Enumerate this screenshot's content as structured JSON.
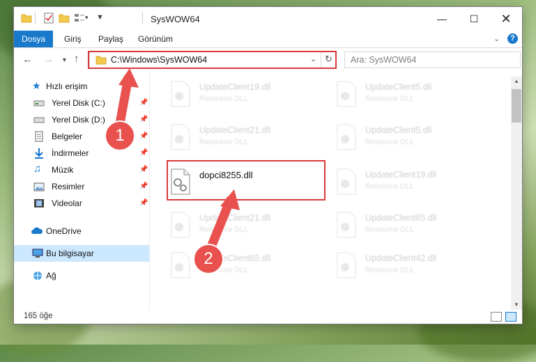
{
  "window": {
    "title": "SysWOW64"
  },
  "ribbon": {
    "tabs": [
      "Dosya",
      "Giriş",
      "Paylaş",
      "Görünüm"
    ]
  },
  "address": {
    "path": "C:\\Windows\\SysWOW64",
    "search_placeholder": "Ara: SysWOW64"
  },
  "sidebar": {
    "quick_access": "Hızlı erişim",
    "items": [
      {
        "label": "Yerel Disk (C:)",
        "icon": "drive-icon"
      },
      {
        "label": "Yerel Disk (D:)",
        "icon": "drive-icon"
      },
      {
        "label": "Belgeler",
        "icon": "documents-icon"
      },
      {
        "label": "İndirmeler",
        "icon": "downloads-icon"
      },
      {
        "label": "Müzik",
        "icon": "music-icon"
      },
      {
        "label": "Resimler",
        "icon": "pictures-icon"
      },
      {
        "label": "Videolar",
        "icon": "videos-icon"
      }
    ],
    "onedrive": "OneDrive",
    "this_pc": "Bu bilgisayar",
    "network": "Ağ"
  },
  "files": {
    "highlighted": {
      "name": "dopci8255.dll"
    },
    "left": [
      {
        "name": "UpdateClient19.dll",
        "desc": "Resource DLL"
      },
      {
        "name": "UpdateClient21.dll",
        "desc": "Resource DLL"
      },
      {
        "name": "UpdateClient21.dll",
        "desc": "Resource DLL"
      },
      {
        "name": "UpdateClient65.dll",
        "desc": "Resource DLL"
      }
    ],
    "right": [
      {
        "name": "UpdateClient5.dll",
        "desc": "Resource DLL"
      },
      {
        "name": "UpdateClient5.dll",
        "desc": "Resource DLL"
      },
      {
        "name": "UpdateClient19.dll",
        "desc": "Resource DLL"
      },
      {
        "name": "UpdateClient65.dll",
        "desc": "Resource DLL"
      },
      {
        "name": "UpdateClient42.dll",
        "desc": "Resource DLL"
      }
    ]
  },
  "annotations": {
    "step1": "1",
    "step2": "2"
  },
  "status": {
    "count": "165 öğe"
  },
  "colors": {
    "accent": "#1979ca",
    "highlight_red": "#d9383a",
    "selected_bg": "#cce8ff"
  }
}
